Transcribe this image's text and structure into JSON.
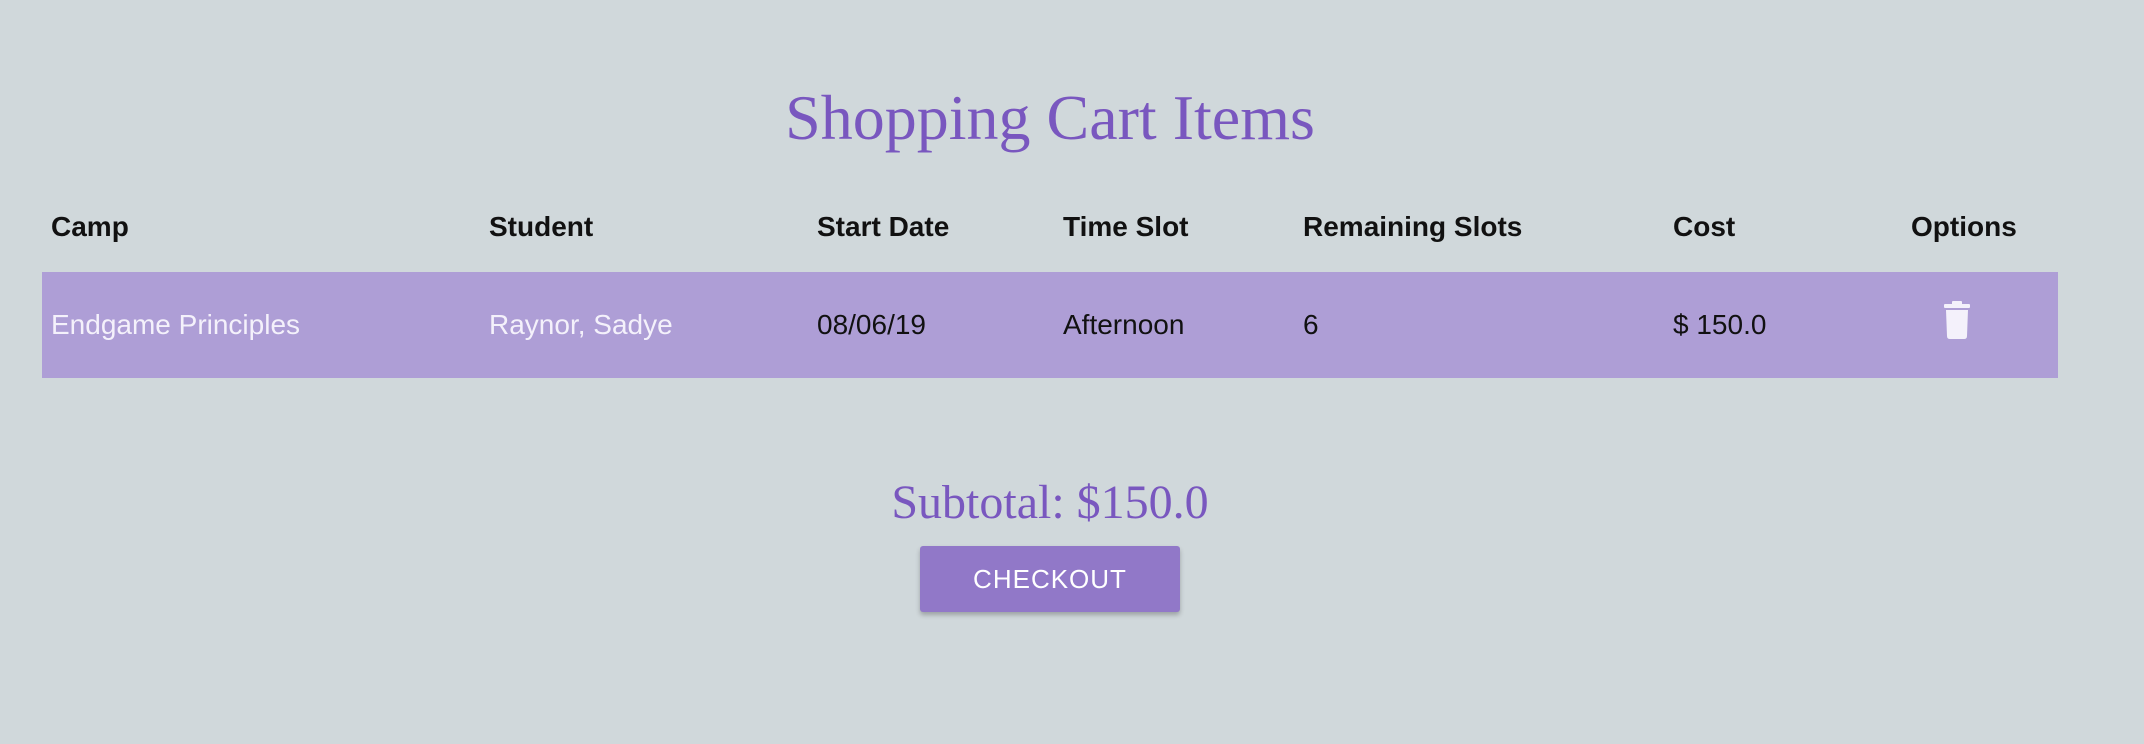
{
  "page": {
    "title": "Shopping Cart Items"
  },
  "table": {
    "headers": {
      "camp": "Camp",
      "student": "Student",
      "start_date": "Start Date",
      "time_slot": "Time Slot",
      "remaining_slots": "Remaining Slots",
      "cost": "Cost",
      "options": "Options"
    },
    "rows": [
      {
        "camp": "Endgame Principles",
        "student": "Raynor, Sadye",
        "start_date": "08/06/19",
        "time_slot": "Afternoon",
        "remaining_slots": "6",
        "cost": "$ 150.0",
        "option_icon": "trash-icon"
      }
    ]
  },
  "summary": {
    "subtotal": "Subtotal: $150.0",
    "checkout_label": "CHECKOUT"
  },
  "colors": {
    "background": "#d0d8db",
    "accent": "#7957bf",
    "row_background": "#ae9ed6",
    "button_background": "#9178c8"
  }
}
